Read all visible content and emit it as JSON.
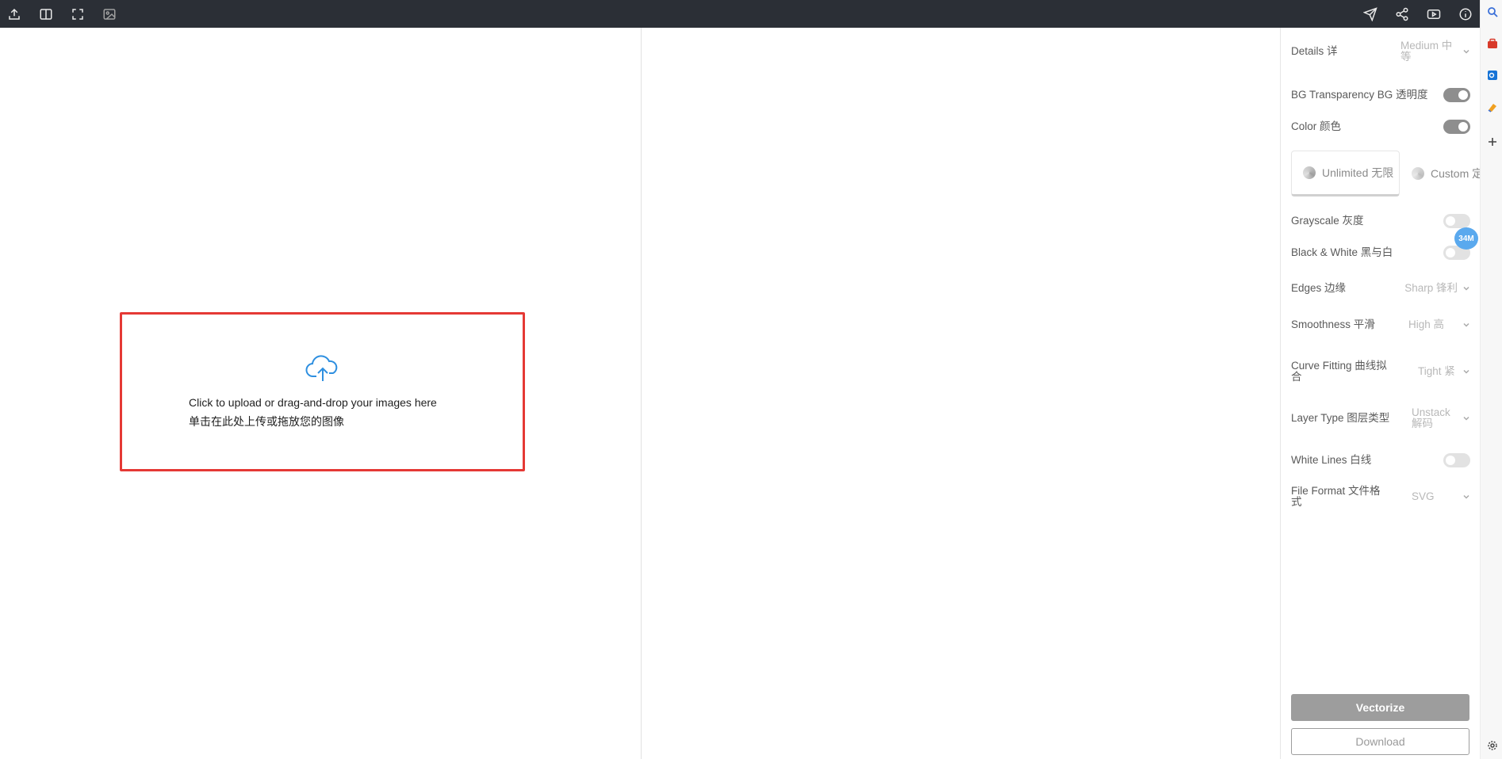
{
  "topbar": {
    "left_icons": [
      "upload-icon",
      "split-view-icon",
      "fullscreen-icon",
      "image-icon"
    ],
    "right_icons": [
      "send-icon",
      "share-icon",
      "video-icon",
      "info-icon"
    ]
  },
  "upload": {
    "line1": "Click to upload or drag-and-drop your images here",
    "line2": "单击在此处上传或拖放您的图像",
    "icon": "cloud-upload-icon",
    "icon_color": "#2e8fe0",
    "border_color": "#e53935"
  },
  "panel": {
    "details": {
      "label": "Details 详",
      "value": "Medium 中等"
    },
    "bg_transparency": {
      "label": "BG Transparency BG 透明度",
      "on": true
    },
    "color": {
      "label": "Color 颜色",
      "on": true
    },
    "palette": {
      "unlimited": "Unlimited 无限",
      "custom": "Custom 定"
    },
    "grayscale": {
      "label": "Grayscale 灰度",
      "on": false
    },
    "black_white": {
      "label": "Black & White 黑与白",
      "on": false
    },
    "edges": {
      "label": "Edges 边缘",
      "value": "Sharp 锋利"
    },
    "smoothness": {
      "label": "Smoothness 平滑",
      "value": "High 高"
    },
    "curve_fitting": {
      "label": "Curve Fitting 曲线拟合",
      "value": "Tight 紧"
    },
    "layer_type": {
      "label": "Layer Type 图层类型",
      "value": "Unstack 解码"
    },
    "white_lines": {
      "label": "White Lines 白线",
      "on": false
    },
    "file_format": {
      "label": "File Format 文件格式",
      "value": "SVG"
    },
    "vectorize_label": "Vectorize",
    "download_label": "Download"
  },
  "badge": "34M",
  "rightbar": {
    "icons": [
      "search-icon",
      "toolbox-icon",
      "outlook-icon",
      "paint-icon",
      "plus-icon",
      "settings-icon"
    ]
  }
}
